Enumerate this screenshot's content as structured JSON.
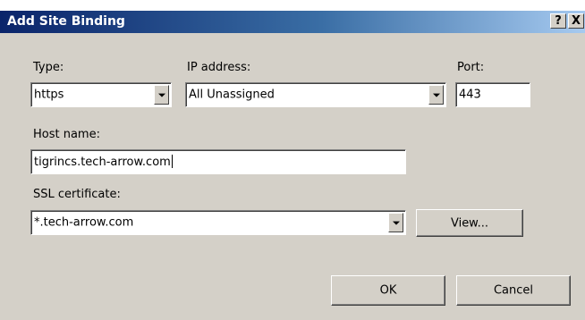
{
  "dialog": {
    "title": "Add Site Binding",
    "help_label": "?",
    "close_label": "X"
  },
  "type": {
    "label": "Type:",
    "value": "https"
  },
  "ip": {
    "label": "IP address:",
    "value": "All Unassigned"
  },
  "port": {
    "label": "Port:",
    "value": "443"
  },
  "host": {
    "label": "Host name:",
    "value": "tigrincs.tech-arrow.com"
  },
  "ssl": {
    "label": "SSL certificate:",
    "value": "*.tech-arrow.com"
  },
  "buttons": {
    "view": "View...",
    "ok": "OK",
    "cancel": "Cancel"
  },
  "colors": {
    "title_bar": "#0a246a",
    "dialog_bg": "#d4d0c8"
  }
}
